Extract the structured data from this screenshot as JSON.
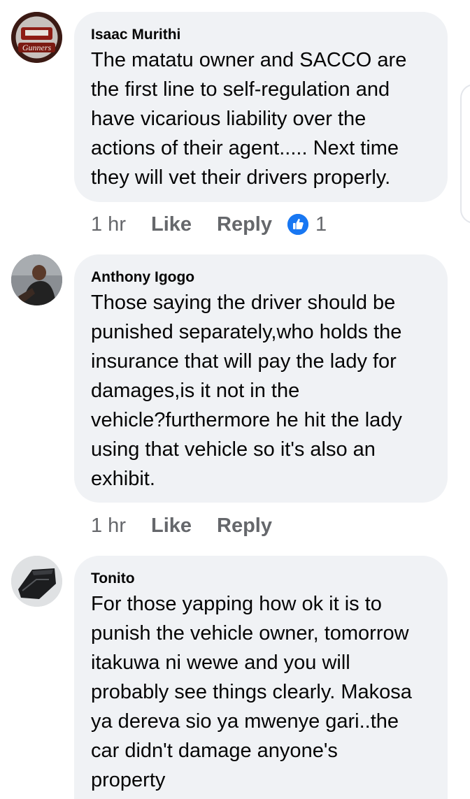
{
  "comments": [
    {
      "author": "Isaac Murithi",
      "text": "The matatu owner and SACCO are\nthe first line to self-regulation and\nhave vicarious liability over the\nactions of their agent..... Next time\nthey will vet their drivers properly.",
      "time": "1 hr",
      "like_label": "Like",
      "reply_label": "Reply",
      "reaction_count": "1",
      "avatar_text": "Gunners"
    },
    {
      "author": "Anthony Igogo",
      "text": "Those saying the driver should be\npunished separately,who holds the\ninsurance that will pay the lady for\ndamages,is it not in the\nvehicle?furthermore he hit the lady\nusing that vehicle so it's also an\nexhibit.",
      "time": "1 hr",
      "like_label": "Like",
      "reply_label": "Reply"
    },
    {
      "author": "Tonito",
      "text": "For those yapping how ok it is to\npunish the vehicle owner, tomorrow\nitakuwa ni wewe and you will\nprobably see things clearly. Makosa\nya dereva sio ya mwenye gari..the\ncar didn't damage anyone's\nproperty"
    }
  ],
  "colors": {
    "bubble": "#f0f2f5",
    "secondary_text": "#65676b",
    "like_blue": "#1877f2"
  },
  "icons": {
    "reaction": "thumbs-up-icon"
  }
}
